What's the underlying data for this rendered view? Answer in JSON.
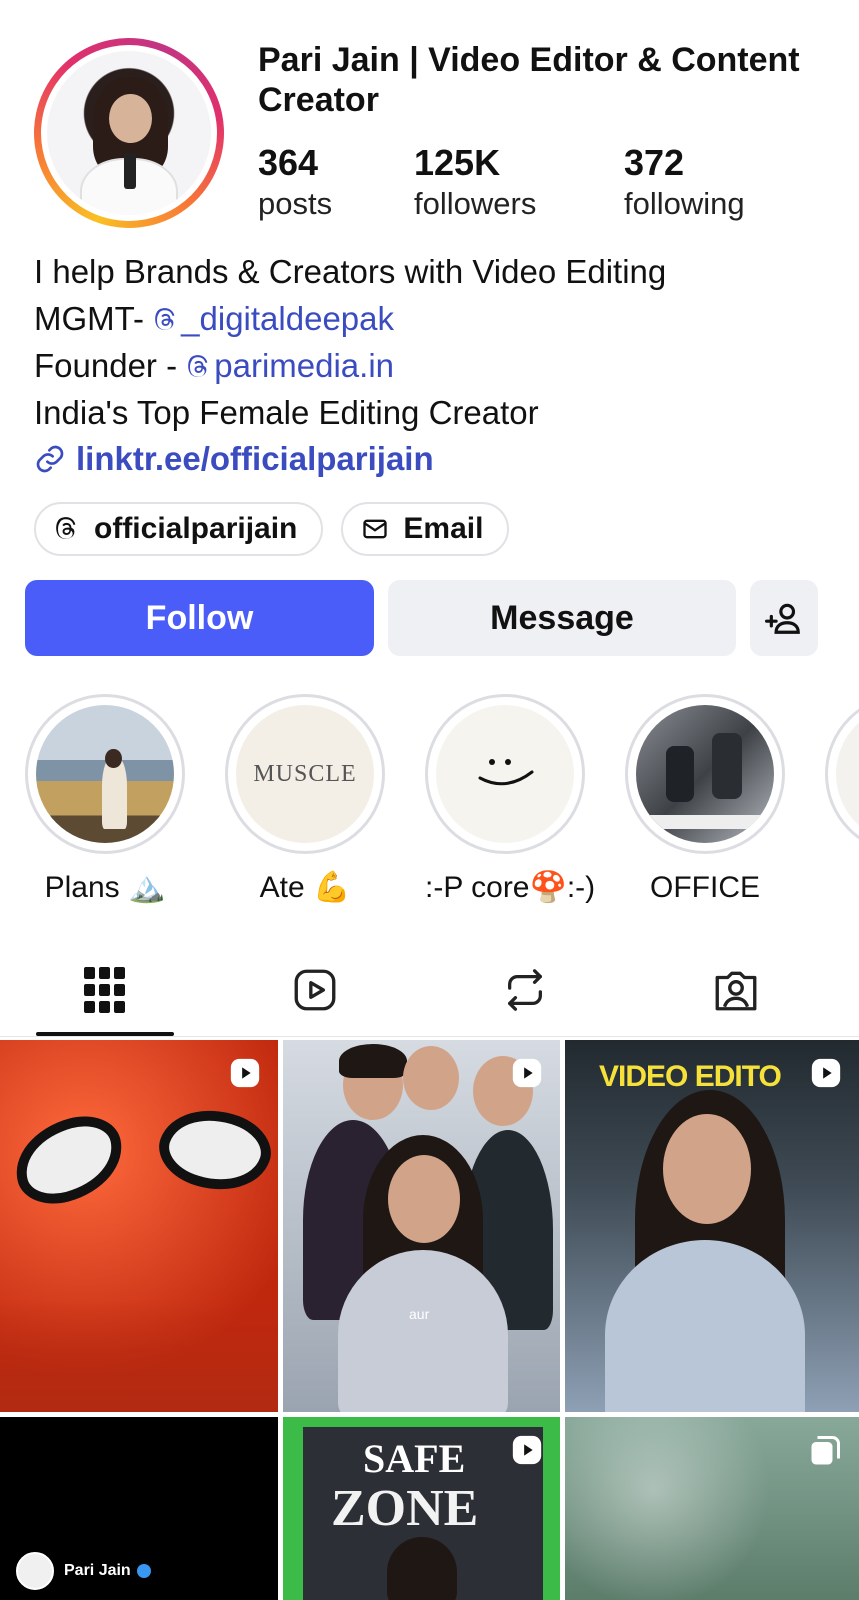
{
  "profile": {
    "display_name": "Pari Jain | Video Editor & Content Creator",
    "stats": [
      {
        "value": "364",
        "label": "posts"
      },
      {
        "value": "125K",
        "label": "followers"
      },
      {
        "value": "372",
        "label": "following"
      }
    ],
    "bio": {
      "line1": "I help Brands & Creators with Video Editing",
      "line2_prefix": "MGMT- ",
      "line2_mention": "_digitaldeepak",
      "line3_prefix": "Founder - ",
      "line3_mention": "parimedia.in",
      "line4": "India's Top Female Editing Creator",
      "link": "linktr.ee/officialparijain"
    },
    "chips": {
      "threads": "officialparijain",
      "email": "Email"
    }
  },
  "actions": {
    "follow": "Follow",
    "message": "Message"
  },
  "highlights": [
    {
      "label": "Plans 🏔️"
    },
    {
      "label": "Ate 💪"
    },
    {
      "label": ":-P core🍄:-)"
    },
    {
      "label": "OFFICE"
    }
  ],
  "highlight_texts": {
    "muscle": "MUSCLE"
  },
  "tabs": [
    "grid",
    "reels",
    "reposts",
    "tagged"
  ],
  "grid": {
    "post3_overlay": "VIDEO EDITO",
    "post2_caption": "aur",
    "post5_overlay_top": "SAFE",
    "post5_overlay_bottom": "ZONE",
    "post4_name": "Pari Jain"
  },
  "colors": {
    "follow_button": "#4a5df9",
    "link": "#3b4cc0",
    "secondary_button": "#eff0f4"
  }
}
